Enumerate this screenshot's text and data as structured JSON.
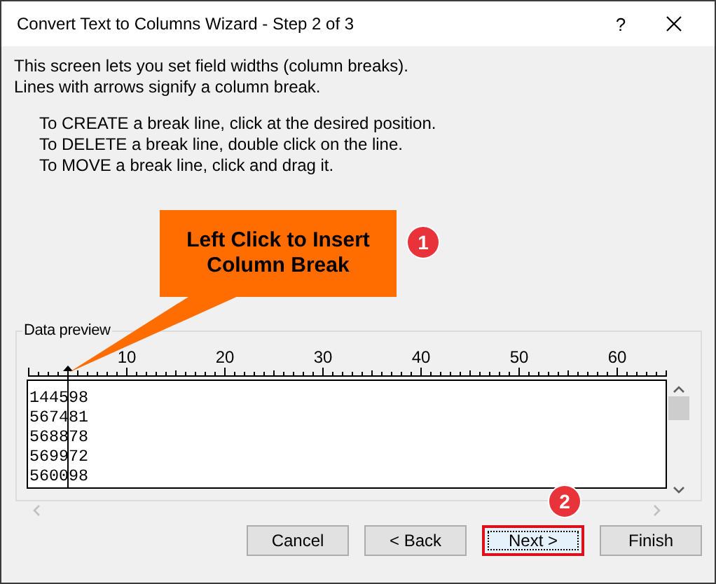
{
  "window": {
    "title": "Convert Text to Columns Wizard - Step 2 of 3",
    "help": "?"
  },
  "intro": [
    "This screen lets you set field widths (column breaks).",
    "Lines with arrows signify a column break."
  ],
  "instructions": [
    "To CREATE a break line, click at the desired position.",
    "To DELETE a break line, double click on the line.",
    "To MOVE a break line, click and drag it."
  ],
  "callout": {
    "text": "Left Click to Insert Column Break",
    "badge": "1"
  },
  "data_preview": {
    "label": "Data preview",
    "ruler_labels": [
      "10",
      "20",
      "30",
      "40",
      "50",
      "60"
    ],
    "break_line": {
      "level": 0.0615
    },
    "rows": [
      "144598",
      "567481",
      "568878",
      "569972",
      "560098"
    ]
  },
  "buttons": [
    {
      "label": "Cancel",
      "highlighted": false
    },
    {
      "label": "< Back",
      "highlighted": false
    },
    {
      "label": "Next >",
      "highlighted": true,
      "badge": "2"
    },
    {
      "label": "Finish",
      "highlighted": false
    }
  ]
}
